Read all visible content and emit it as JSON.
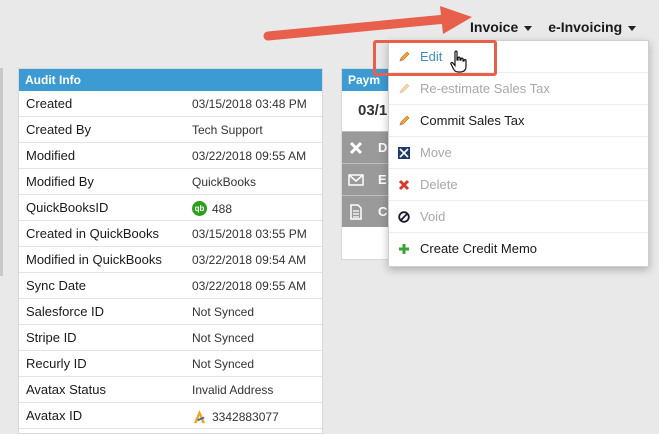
{
  "top_nav": {
    "invoice": "Invoice",
    "e_invoicing": "e-Invoicing"
  },
  "audit": {
    "header": "Audit Info",
    "rows": [
      {
        "label": "Created",
        "value": "03/15/2018 03:48 PM"
      },
      {
        "label": "Created By",
        "value": "Tech Support"
      },
      {
        "label": "Modified",
        "value": "03/22/2018 09:55 AM"
      },
      {
        "label": "Modified By",
        "value": "QuickBooks"
      },
      {
        "label": "QuickBooksID",
        "value": "488",
        "icon": "quickbooks-icon"
      },
      {
        "label": "Created in QuickBooks",
        "value": "03/15/2018 03:55 PM"
      },
      {
        "label": "Modified in QuickBooks",
        "value": "03/22/2018 09:54 AM"
      },
      {
        "label": "Sync Date",
        "value": "03/22/2018 09:55 AM"
      },
      {
        "label": "Salesforce ID",
        "value": "Not Synced"
      },
      {
        "label": "Stripe ID",
        "value": "Not Synced"
      },
      {
        "label": "Recurly ID",
        "value": "Not Synced"
      },
      {
        "label": "Avatax Status",
        "value": "Invalid Address"
      },
      {
        "label": "Avatax ID",
        "value": "3342883077",
        "icon": "avatax-icon"
      }
    ]
  },
  "payment": {
    "header": "Paym",
    "date": "03/1",
    "actions": [
      {
        "icon": "close-icon",
        "label": "D"
      },
      {
        "icon": "envelope-icon",
        "label": "E"
      },
      {
        "icon": "document-icon",
        "label": "C"
      }
    ]
  },
  "dropdown": {
    "items": [
      {
        "label": "Edit",
        "icon": "pencil-icon",
        "state": "edit"
      },
      {
        "label": "Re-estimate Sales Tax",
        "icon": "pencil-icon",
        "state": "disabled"
      },
      {
        "label": "Commit Sales Tax",
        "icon": "pencil-icon",
        "state": "enabled"
      },
      {
        "label": "Move",
        "icon": "move-icon",
        "state": "disabled"
      },
      {
        "label": "Delete",
        "icon": "delete-icon",
        "state": "disabled"
      },
      {
        "label": "Void",
        "icon": "void-icon",
        "state": "disabled"
      },
      {
        "label": "Create Credit Memo",
        "icon": "plus-icon",
        "state": "enabled"
      }
    ]
  },
  "colors": {
    "header_blue": "#3d9bd3",
    "annotation_red": "#e85f4c",
    "quickbooks_green": "#2ca01c",
    "link_blue": "#3d8ec8"
  }
}
